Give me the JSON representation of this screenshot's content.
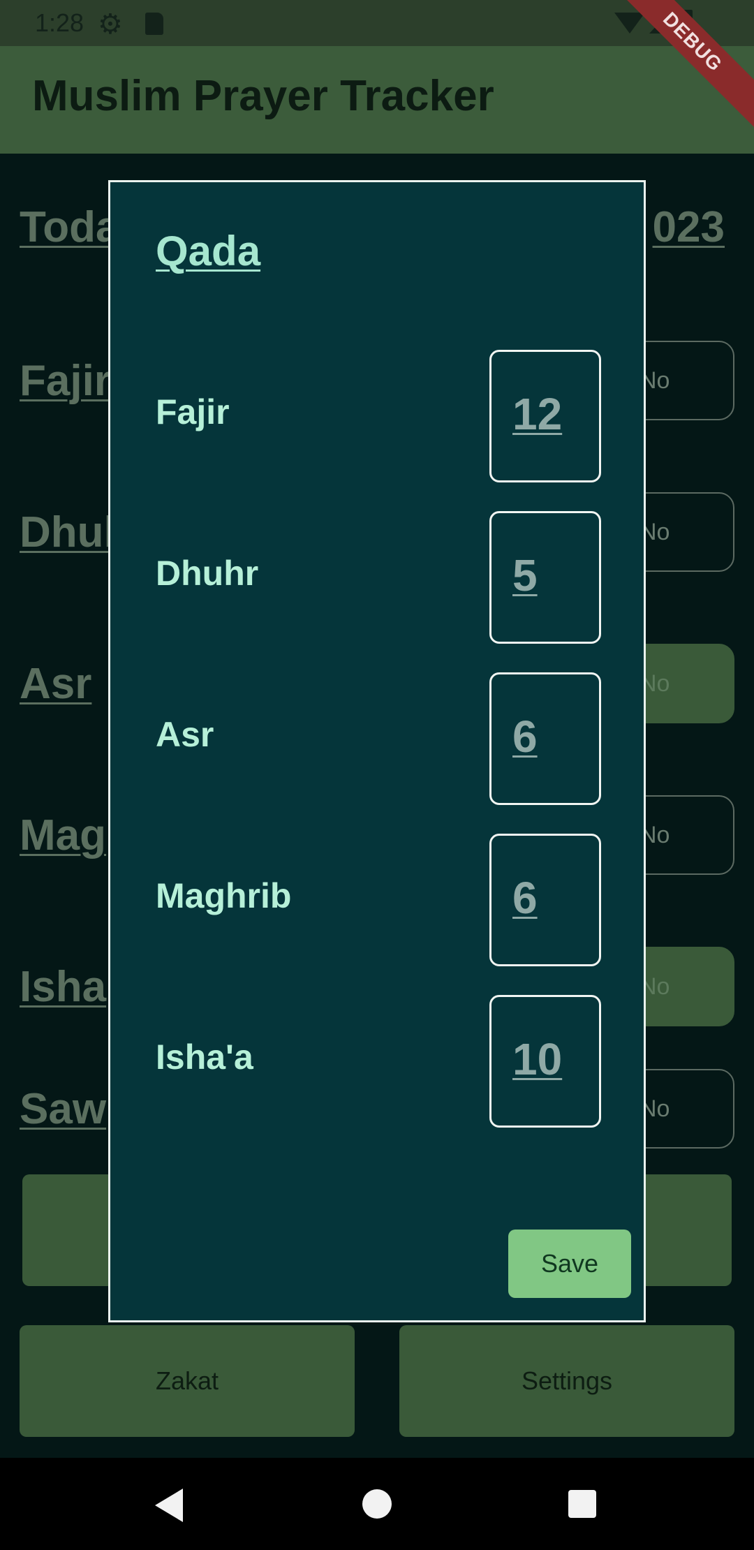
{
  "status_bar": {
    "time": "1:28"
  },
  "app_bar": {
    "title": "Muslim Prayer Tracker",
    "debug_label": "DEBUG"
  },
  "background": {
    "today_label": "Toda",
    "date_fragment": "023",
    "prayers": [
      {
        "label": "Fajir",
        "toggle": "No",
        "toggle_filled": false
      },
      {
        "label": "Dhul",
        "toggle": "No",
        "toggle_filled": false
      },
      {
        "label": "Asr",
        "toggle": "No",
        "toggle_filled": true
      },
      {
        "label": "Mag",
        "toggle": "No",
        "toggle_filled": false
      },
      {
        "label": "Isha",
        "toggle": "No",
        "toggle_filled": true
      },
      {
        "label": "Saw",
        "toggle": "No",
        "toggle_filled": false
      }
    ],
    "buttons": {
      "zakat": "Zakat",
      "settings": "Settings"
    }
  },
  "dialog": {
    "title": "Qada",
    "rows": [
      {
        "label": "Fajir",
        "count": "12"
      },
      {
        "label": "Dhuhr",
        "count": "5"
      },
      {
        "label": "Asr",
        "count": "6"
      },
      {
        "label": "Maghrib",
        "count": "6"
      },
      {
        "label": "Isha'a",
        "count": "10"
      }
    ],
    "save_label": "Save"
  },
  "colors": {
    "app_bar": "#3c5c3b",
    "dialog_bg": "#05353a",
    "save_button": "#81c784",
    "label_text": "#b6f0d8"
  }
}
